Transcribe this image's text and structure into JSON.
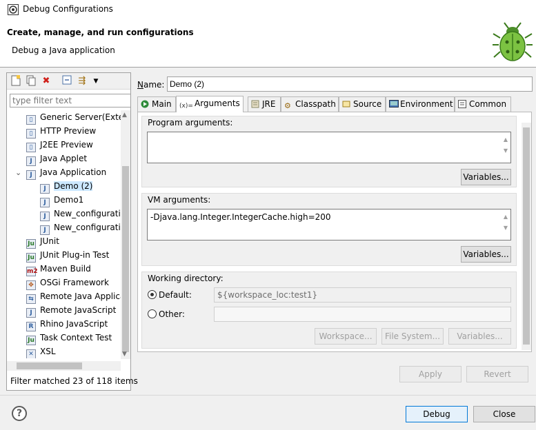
{
  "window": {
    "title": "Debug Configurations"
  },
  "header": {
    "title": "Create, manage, and run configurations",
    "subtitle": "Debug a Java application",
    "icon": "bug-icon"
  },
  "left": {
    "filter_placeholder": "type filter text",
    "tree": [
      {
        "label": "Generic Server(Exter",
        "icon": "server-icon",
        "indent": 0
      },
      {
        "label": "HTTP Preview",
        "icon": "server-icon",
        "indent": 0
      },
      {
        "label": "J2EE Preview",
        "icon": "server-icon",
        "indent": 0
      },
      {
        "label": "Java Applet",
        "icon": "applet-icon",
        "indent": 0
      },
      {
        "label": "Java Application",
        "icon": "java-app-icon",
        "indent": 0,
        "expanded": true
      },
      {
        "label": "Demo (2)",
        "icon": "java-app-icon",
        "indent": 1,
        "selected": true
      },
      {
        "label": "Demo1",
        "icon": "java-app-icon",
        "indent": 1
      },
      {
        "label": "New_configuratio",
        "icon": "java-app-icon",
        "indent": 1
      },
      {
        "label": "New_configuratio",
        "icon": "java-app-icon",
        "indent": 1
      },
      {
        "label": "JUnit",
        "icon": "junit-icon",
        "indent": 0
      },
      {
        "label": "JUnit Plug-in Test",
        "icon": "junit-plugin-icon",
        "indent": 0
      },
      {
        "label": "Maven Build",
        "icon": "maven-icon",
        "indent": 0
      },
      {
        "label": "OSGi Framework",
        "icon": "osgi-icon",
        "indent": 0
      },
      {
        "label": "Remote Java Applica",
        "icon": "remote-java-icon",
        "indent": 0
      },
      {
        "label": "Remote JavaScript",
        "icon": "remote-js-icon",
        "indent": 0
      },
      {
        "label": "Rhino JavaScript",
        "icon": "rhino-icon",
        "indent": 0
      },
      {
        "label": "Task Context Test",
        "icon": "task-test-icon",
        "indent": 0
      },
      {
        "label": "XSL",
        "icon": "xsl-icon",
        "indent": 0
      }
    ],
    "status": "Filter matched 23 of 118 items"
  },
  "right": {
    "name_label": "Name:",
    "name_value": "Demo (2)",
    "tabs": [
      {
        "label": "Main",
        "icon": "main-tab-icon"
      },
      {
        "label": "Arguments",
        "icon": "arguments-tab-icon",
        "active": true
      },
      {
        "label": "JRE",
        "icon": "jre-tab-icon"
      },
      {
        "label": "Classpath",
        "icon": "classpath-tab-icon"
      },
      {
        "label": "Source",
        "icon": "source-tab-icon"
      },
      {
        "label": "Environment",
        "icon": "environment-tab-icon"
      },
      {
        "label": "Common",
        "icon": "common-tab-icon"
      }
    ],
    "program_args": {
      "label": "Program arguments:",
      "value": "",
      "button": "Variables..."
    },
    "vm_args": {
      "label": "VM arguments:",
      "value": "-Djava.lang.Integer.IntegerCache.high=200",
      "button": "Variables..."
    },
    "working_dir": {
      "label": "Working directory:",
      "default_label": "Default:",
      "default_value": "${workspace_loc:test1}",
      "other_label": "Other:",
      "other_value": "",
      "buttons": {
        "workspace": "Workspace...",
        "filesystem": "File System...",
        "variables": "Variables..."
      }
    },
    "apply": "Apply",
    "revert": "Revert"
  },
  "footer": {
    "debug": "Debug",
    "close": "Close"
  },
  "colors": {
    "selection": "#cce8ff",
    "accent": "#0078d7"
  }
}
